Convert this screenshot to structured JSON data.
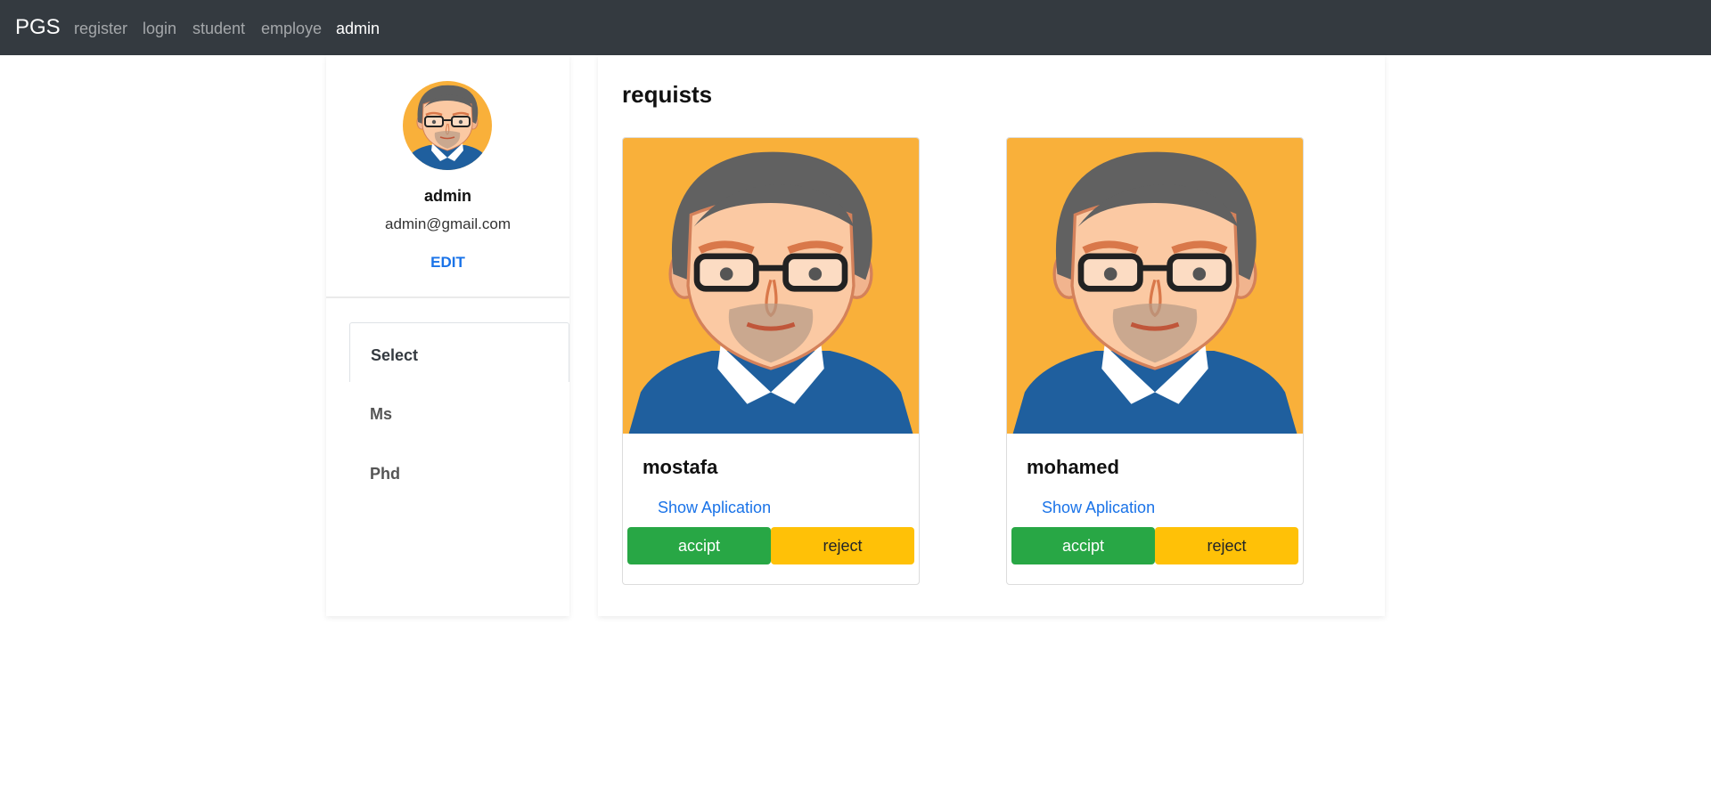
{
  "navbar": {
    "brand": "PGS",
    "links": [
      {
        "label": "register"
      },
      {
        "label": "login"
      },
      {
        "label": "student"
      },
      {
        "label": "employe"
      },
      {
        "label": "admin"
      }
    ]
  },
  "profile": {
    "name": "admin",
    "email": "admin@gmail.com",
    "edit_label": "EDIT",
    "avatar_icon": "cartoon-man-avatar"
  },
  "menu": {
    "items": [
      {
        "label": "Select"
      },
      {
        "label": "Ms"
      },
      {
        "label": "Phd"
      }
    ]
  },
  "requests": {
    "title": "requists",
    "cards": [
      {
        "name": "mostafa",
        "link_label": "Show Aplication",
        "accept_label": "accipt",
        "reject_label": "reject"
      },
      {
        "name": "mohamed",
        "link_label": "Show Aplication",
        "accept_label": "accipt",
        "reject_label": "reject"
      }
    ]
  },
  "colors": {
    "navbar_bg": "#343a40",
    "link_blue": "#1a73e8",
    "accept_green": "#28a745",
    "reject_yellow": "#ffc107",
    "avatar_orange": "#f9b03a"
  }
}
